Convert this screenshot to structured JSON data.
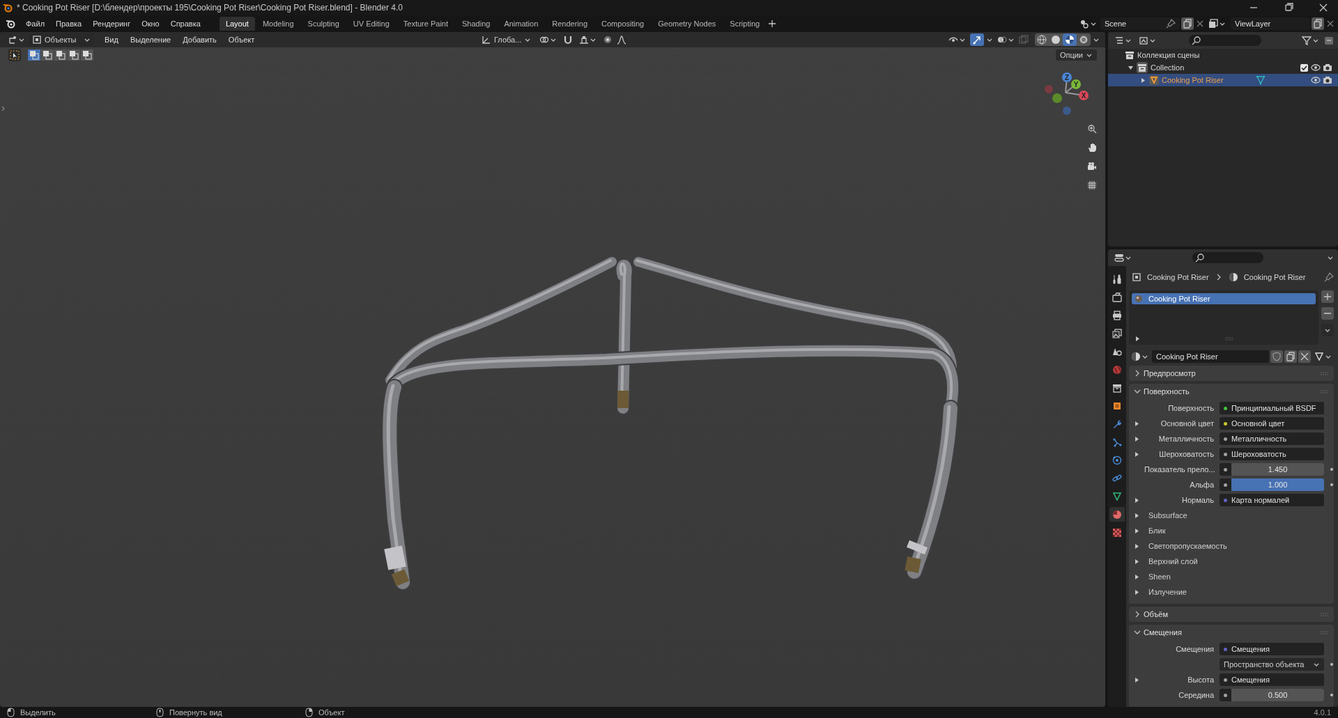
{
  "window": {
    "title": "* Cooking Pot Riser [D:\\блендер\\проекты 195\\Cooking Pot Riser\\Cooking Pot Riser.blend] - Blender 4.0"
  },
  "menu": [
    "Файл",
    "Правка",
    "Рендеринг",
    "Окно",
    "Справка"
  ],
  "workspaces": [
    {
      "label": "Layout",
      "selected": true
    },
    {
      "label": "Modeling",
      "selected": false
    },
    {
      "label": "Sculpting",
      "selected": false
    },
    {
      "label": "UV Editing",
      "selected": false
    },
    {
      "label": "Texture Paint",
      "selected": false
    },
    {
      "label": "Shading",
      "selected": false
    },
    {
      "label": "Animation",
      "selected": false
    },
    {
      "label": "Rendering",
      "selected": false
    },
    {
      "label": "Compositing",
      "selected": false
    },
    {
      "label": "Geometry Nodes",
      "selected": false
    },
    {
      "label": "Scripting",
      "selected": false
    }
  ],
  "scene": "Scene",
  "view_layer": "ViewLayer",
  "viewport": {
    "mode": "Объекты",
    "menus": [
      "Вид",
      "Выделение",
      "Добавить",
      "Объект"
    ],
    "orientation": "Глоба...",
    "options": "Опции",
    "show_gizmos": true,
    "select_modes": [
      {
        "selected": true
      },
      {
        "selected": false
      },
      {
        "selected": false
      },
      {
        "selected": false
      },
      {
        "selected": false
      }
    ],
    "shading": [
      {
        "kind": "wireframe",
        "selected": false
      },
      {
        "kind": "solid",
        "selected": false
      },
      {
        "kind": "material",
        "selected": true
      },
      {
        "kind": "rendered",
        "selected": false
      }
    ],
    "axes": [
      "X",
      "Y",
      "Z"
    ]
  },
  "outliner": {
    "root": {
      "label": "Коллекция сцены",
      "children": [
        {
          "label": "Collection",
          "expanded": true,
          "checked": true,
          "kind": "collection",
          "children": [
            {
              "label": "Cooking Pot Riser",
              "expanded": false,
              "selected": true,
              "kind": "mesh"
            }
          ]
        }
      ]
    }
  },
  "properties": {
    "tabs": [
      {
        "kind": "tool",
        "selected": false
      },
      {
        "kind": "render",
        "selected": false
      },
      {
        "kind": "output",
        "selected": false
      },
      {
        "kind": "view_layer",
        "selected": false
      },
      {
        "kind": "scene",
        "selected": false
      },
      {
        "kind": "world",
        "selected": false
      },
      {
        "kind": "collection",
        "selected": false
      },
      {
        "kind": "object",
        "selected": false
      },
      {
        "kind": "modifiers",
        "selected": false
      },
      {
        "kind": "particles",
        "selected": false
      },
      {
        "kind": "physics",
        "selected": false
      },
      {
        "kind": "constraints",
        "selected": false
      },
      {
        "kind": "data",
        "selected": false
      },
      {
        "kind": "material",
        "selected": true
      },
      {
        "kind": "texture",
        "selected": false
      }
    ],
    "breadcrumb": [
      "Cooking Pot Riser",
      "Cooking Pot Riser"
    ],
    "material_slots": [
      {
        "label": "Cooking Pot Riser",
        "selected": true
      }
    ],
    "material_name": "Cooking Pot Riser",
    "panels": [
      {
        "title": "Предпросмотр",
        "expanded": false
      },
      {
        "title": "Поверхность",
        "expanded": true,
        "rows": [
          {
            "kind": "socket",
            "label": "Поверхность",
            "value": "Принципиальный BSDF",
            "color": "#3fc43f",
            "expandable": false
          },
          {
            "kind": "socket",
            "label": "Основной цвет",
            "value": "Основной цвет",
            "color": "#c7c729",
            "expandable": true
          },
          {
            "kind": "socket",
            "label": "Металличность",
            "value": "Металличность",
            "color": "#a1a1a1",
            "expandable": true
          },
          {
            "kind": "socket",
            "label": "Шероховатость",
            "value": "Шероховатость",
            "color": "#a1a1a1",
            "expandable": true
          },
          {
            "kind": "number",
            "label": "Показатель прело...",
            "value": "1.450",
            "color": "#a1a1a1"
          },
          {
            "kind": "slider",
            "label": "Альфа",
            "value": "1.000",
            "color": "#a1a1a1",
            "level": 1
          },
          {
            "kind": "socket",
            "label": "Нормаль",
            "value": "Карта нормалей",
            "color": "#6363c7",
            "expandable": true
          },
          {
            "kind": "subpanel",
            "label": "Subsurface"
          },
          {
            "kind": "subpanel",
            "label": "Блик"
          },
          {
            "kind": "subpanel",
            "label": "Светопропускаемость"
          },
          {
            "kind": "subpanel",
            "label": "Верхний слой"
          },
          {
            "kind": "subpanel",
            "label": "Sheen"
          },
          {
            "kind": "subpanel",
            "label": "Излучение"
          }
        ]
      },
      {
        "title": "Объём",
        "expanded": false
      },
      {
        "title": "Смещения",
        "expanded": true,
        "rows": [
          {
            "kind": "socket",
            "label": "Смещения",
            "value": "Смещения",
            "color": "#6363c7",
            "expandable": false
          },
          {
            "kind": "dropdown",
            "value": "Пространство объекта"
          },
          {
            "kind": "socket",
            "label": "Высота",
            "value": "Смещения",
            "color": "#a1a1a1",
            "expandable": true
          },
          {
            "kind": "number",
            "label": "Середина",
            "value": "0.500",
            "color": "#a1a1a1"
          }
        ]
      }
    ]
  },
  "status_bar": {
    "hints": [
      "Выделить",
      "Повернуть вид",
      "Объект"
    ],
    "version": "4.0.1"
  }
}
